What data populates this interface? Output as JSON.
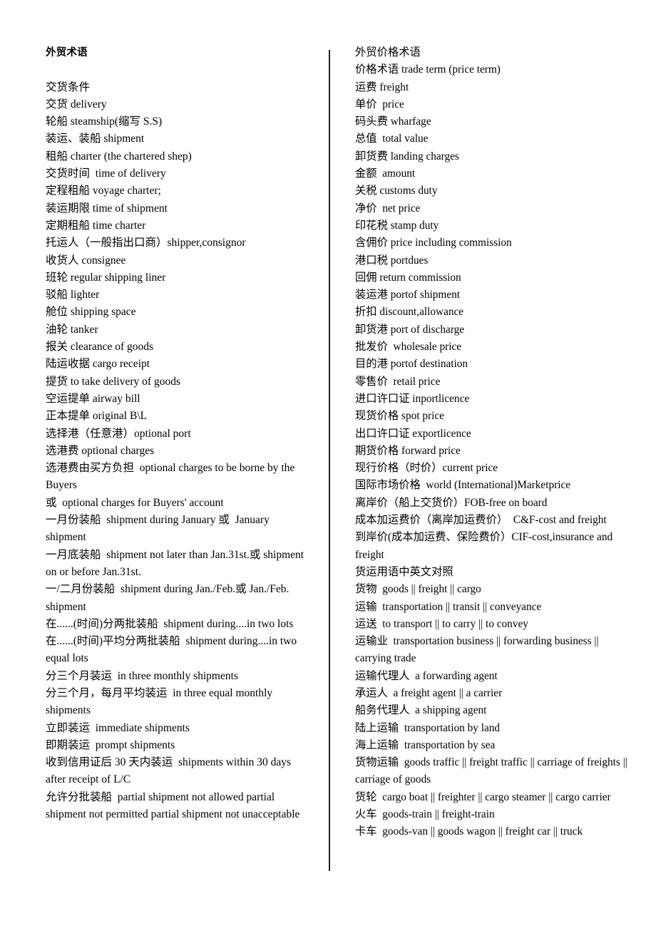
{
  "document": {
    "title": "外贸术语",
    "left_column": {
      "heading": "外贸术语",
      "section_label": "交货条件",
      "entries": [
        "交货 delivery",
        "轮船 steamship(缩写 S.S)",
        "装运、装船 shipment",
        "租船 charter (the chartered shep)",
        "交货时间  time of delivery",
        "定程租船 voyage charter;",
        "装运期限 time of shipment",
        "定期租船 time charter",
        "托运人（一般指出口商）shipper,consignor",
        "收货人 consignee",
        "班轮 regular shipping liner",
        "驳船 lighter",
        "舱位 shipping space",
        "油轮 tanker",
        "报关 clearance of goods",
        "陆运收据 cargo receipt",
        "提货 to take delivery of goods",
        "空运提单 airway bill",
        "正本提单 original B\\L",
        "选择港（任意港）optional port",
        "选港费 optional charges",
        "选港费由买方负担  optional charges to be borne by the Buyers",
        "或  optional charges for Buyers' account",
        "一月份装船  shipment during January 或  January shipment",
        "一月底装船  shipment not later than Jan.31st.或 shipment on or before Jan.31st.",
        "一/二月份装船  shipment during Jan./Feb.或 Jan./Feb. shipment",
        "在......(时间)分两批装船  shipment during....in two lots",
        "在......(时间)平均分两批装船  shipment during....in two equal lots",
        "分三个月装运  in three monthly shipments",
        "分三个月，每月平均装运  in three equal monthly shipments",
        "立即装运  immediate shipments",
        "即期装运  prompt shipments",
        "收到信用证后 30 天内装运  shipments within 30 days after receipt of L/C",
        "允许分批装船  partial shipment not allowed partial shipment not permitted partial shipment not unacceptable"
      ]
    },
    "right_column": {
      "heading": "外贸价格术语",
      "entries": [
        "价格术语 trade term (price term)",
        "运费 freight",
        "单价  price",
        "码头费 wharfage",
        "总值  total value",
        "卸货费 landing charges",
        "金额  amount",
        "关税 customs duty",
        "净价  net price",
        "印花税 stamp duty",
        "含佣价 price including commission",
        "港口税 portdues",
        "回佣 return commission",
        "装运港 portof shipment",
        "折扣 discount,allowance",
        "卸货港 port of discharge",
        "批发价  wholesale price",
        "目的港 portof destination",
        "零售价  retail price",
        "进口许口证 inportlicence",
        "现货价格 spot price",
        "出口许口证 exportlicence",
        "期货价格 forward price",
        "现行价格（时价）current price",
        "国际市场价格  world (International)Marketprice",
        "离岸价（船上交货价）FOB-free on board",
        "成本加运费价（离岸加运费价）  C&F-cost and freight",
        "到岸价(成本加运费、保险费价）CIF-cost,insurance and freight",
        "货运用语中英文对照",
        "货物  goods || freight || cargo",
        "运输  transportation || transit || conveyance",
        "运送  to transport || to carry || to convey",
        "运输业  transportation business || forwarding business || carrying trade",
        "运输代理人  a forwarding agent",
        "承运人  a freight agent || a carrier",
        "船务代理人  a shipping agent",
        "陆上运输  transportation by land",
        "海上运输  transportation by sea",
        "货物运输  goods traffic || freight traffic || carriage of freights || carriage of goods",
        "货轮  cargo boat || freighter || cargo steamer || cargo carrier",
        "火车  goods-train || freight-train",
        "卡车  goods-van || goods wagon || freight car || truck"
      ]
    }
  },
  "colors": {
    "text": "#000000",
    "background": "#ffffff",
    "divider": "#202020"
  }
}
